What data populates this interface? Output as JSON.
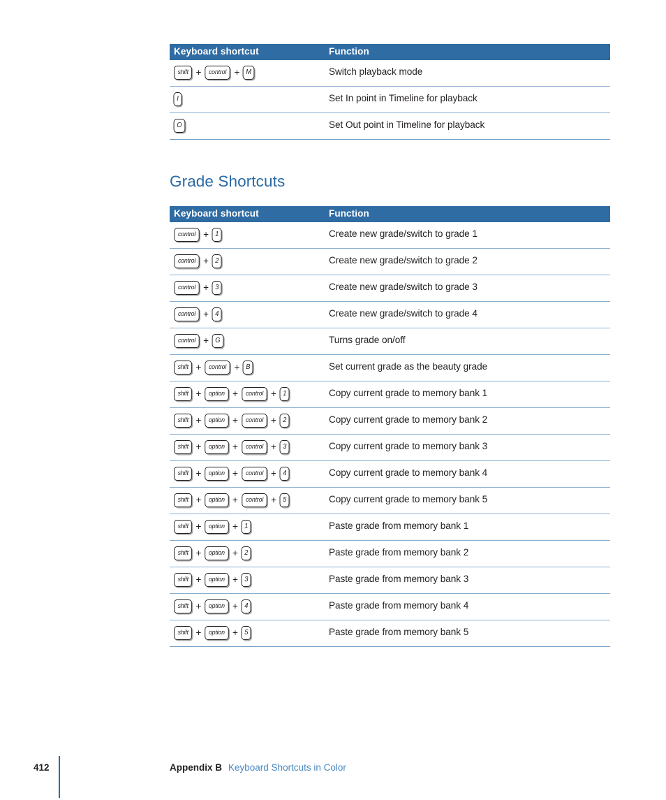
{
  "page": {
    "number": "412",
    "footer_appendix": "Appendix B",
    "footer_chapter": "Keyboard Shortcuts in Color",
    "accent_blue": "#2f6ca3",
    "heading_blue": "#2a6aa5",
    "rule_blue": "#89aed0",
    "link_blue": "#4a87c4"
  },
  "heading": {
    "grade_shortcuts": "Grade Shortcuts"
  },
  "columns": {
    "shortcut": "Keyboard shortcut",
    "function": "Function"
  },
  "plus": "+",
  "playback_table": {
    "rows": [
      {
        "keys": [
          "shift",
          "control",
          "M"
        ],
        "function": "Switch playback mode"
      },
      {
        "keys": [
          "I"
        ],
        "function": "Set In point in Timeline for playback"
      },
      {
        "keys": [
          "O"
        ],
        "function": "Set Out point in Timeline for playback"
      }
    ]
  },
  "grade_table": {
    "rows": [
      {
        "keys": [
          "control",
          "1"
        ],
        "function": "Create new grade/switch to grade 1"
      },
      {
        "keys": [
          "control",
          "2"
        ],
        "function": "Create new grade/switch to grade 2"
      },
      {
        "keys": [
          "control",
          "3"
        ],
        "function": "Create new grade/switch to grade 3"
      },
      {
        "keys": [
          "control",
          "4"
        ],
        "function": "Create new grade/switch to grade 4"
      },
      {
        "keys": [
          "control",
          "G"
        ],
        "function": "Turns grade on/off"
      },
      {
        "keys": [
          "shift",
          "control",
          "B"
        ],
        "function": "Set current grade as the beauty grade"
      },
      {
        "keys": [
          "shift",
          "option",
          "control",
          "1"
        ],
        "function": "Copy current grade to memory bank 1"
      },
      {
        "keys": [
          "shift",
          "option",
          "control",
          "2"
        ],
        "function": "Copy current grade to memory bank 2"
      },
      {
        "keys": [
          "shift",
          "option",
          "control",
          "3"
        ],
        "function": "Copy current grade to memory bank 3"
      },
      {
        "keys": [
          "shift",
          "option",
          "control",
          "4"
        ],
        "function": "Copy current grade to memory bank 4"
      },
      {
        "keys": [
          "shift",
          "option",
          "control",
          "5"
        ],
        "function": "Copy current grade to memory bank 5"
      },
      {
        "keys": [
          "shift",
          "option",
          "1"
        ],
        "function": "Paste grade from memory bank 1"
      },
      {
        "keys": [
          "shift",
          "option",
          "2"
        ],
        "function": "Paste grade from memory bank 2"
      },
      {
        "keys": [
          "shift",
          "option",
          "3"
        ],
        "function": "Paste grade from memory bank 3"
      },
      {
        "keys": [
          "shift",
          "option",
          "4"
        ],
        "function": "Paste grade from memory bank 4"
      },
      {
        "keys": [
          "shift",
          "option",
          "5"
        ],
        "function": "Paste grade from memory bank 5"
      }
    ]
  }
}
